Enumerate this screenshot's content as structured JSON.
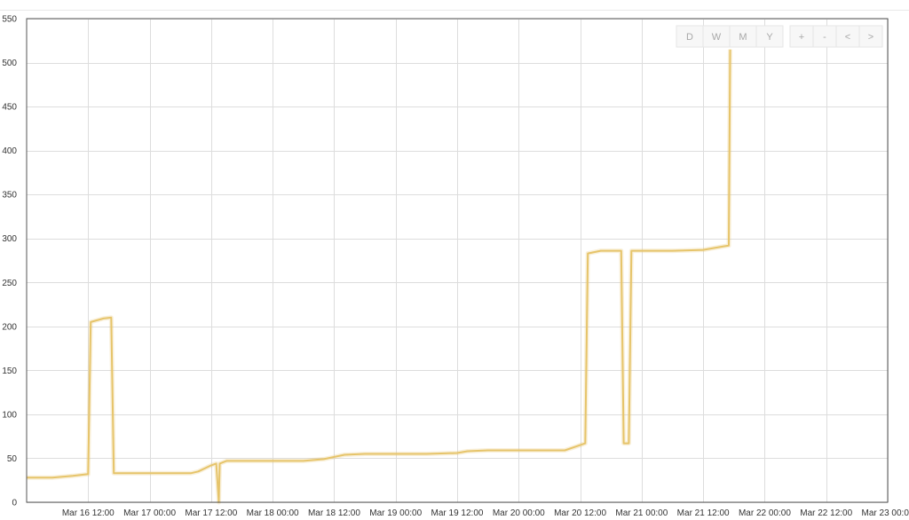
{
  "controls": {
    "range": [
      "D",
      "W",
      "M",
      "Y"
    ],
    "zoom": [
      "+",
      "-",
      "<",
      ">"
    ],
    "active": "W"
  },
  "colors": {
    "line": "#e6c46a",
    "grid": "#dddddd",
    "frame": "#555555"
  },
  "chart_data": {
    "type": "line",
    "title": "",
    "xlabel": "",
    "ylabel": "",
    "ylim": [
      0,
      550
    ],
    "xlim": [
      "2024-03-16 00:00",
      "2024-03-23 00:00"
    ],
    "yticks": [
      0,
      50,
      100,
      150,
      200,
      250,
      300,
      350,
      400,
      450,
      500,
      550
    ],
    "xticks": [
      {
        "t": "2024-03-16 12:00",
        "label": "Mar 16 12:00"
      },
      {
        "t": "2024-03-17 00:00",
        "label": "Mar 17 00:00"
      },
      {
        "t": "2024-03-17 12:00",
        "label": "Mar 17 12:00"
      },
      {
        "t": "2024-03-18 00:00",
        "label": "Mar 18 00:00"
      },
      {
        "t": "2024-03-18 12:00",
        "label": "Mar 18 12:00"
      },
      {
        "t": "2024-03-19 00:00",
        "label": "Mar 19 00:00"
      },
      {
        "t": "2024-03-19 12:00",
        "label": "Mar 19 12:00"
      },
      {
        "t": "2024-03-20 00:00",
        "label": "Mar 20 00:00"
      },
      {
        "t": "2024-03-20 12:00",
        "label": "Mar 20 12:00"
      },
      {
        "t": "2024-03-21 00:00",
        "label": "Mar 21 00:00"
      },
      {
        "t": "2024-03-21 12:00",
        "label": "Mar 21 12:00"
      },
      {
        "t": "2024-03-22 00:00",
        "label": "Mar 22 00:00"
      },
      {
        "t": "2024-03-22 12:00",
        "label": "Mar 22 12:00"
      },
      {
        "t": "2024-03-23 00:00",
        "label": "Mar 23 00:00"
      }
    ],
    "grid": true,
    "legend": "none",
    "series": [
      {
        "color": "#e6c46a",
        "points": [
          [
            "2024-03-16 00:00",
            28
          ],
          [
            "2024-03-16 05:00",
            28
          ],
          [
            "2024-03-16 09:00",
            30
          ],
          [
            "2024-03-16 12:00",
            32
          ],
          [
            "2024-03-16 12:30",
            205
          ],
          [
            "2024-03-16 15:00",
            209
          ],
          [
            "2024-03-16 16:30",
            210
          ],
          [
            "2024-03-16 17:00",
            33
          ],
          [
            "2024-03-17 00:00",
            33
          ],
          [
            "2024-03-17 08:00",
            33
          ],
          [
            "2024-03-17 09:30",
            35
          ],
          [
            "2024-03-17 12:00",
            42
          ],
          [
            "2024-03-17 13:00",
            44
          ],
          [
            "2024-03-17 13:30",
            0
          ],
          [
            "2024-03-17 13:40",
            44
          ],
          [
            "2024-03-17 15:00",
            47
          ],
          [
            "2024-03-18 00:00",
            47
          ],
          [
            "2024-03-18 06:00",
            47
          ],
          [
            "2024-03-18 10:00",
            49
          ],
          [
            "2024-03-18 14:00",
            54
          ],
          [
            "2024-03-18 18:00",
            55
          ],
          [
            "2024-03-19 00:00",
            55
          ],
          [
            "2024-03-19 06:00",
            55
          ],
          [
            "2024-03-19 12:00",
            56
          ],
          [
            "2024-03-19 14:00",
            58
          ],
          [
            "2024-03-19 18:00",
            59
          ],
          [
            "2024-03-20 00:00",
            59
          ],
          [
            "2024-03-20 09:00",
            59
          ],
          [
            "2024-03-20 11:00",
            63
          ],
          [
            "2024-03-20 13:00",
            67
          ],
          [
            "2024-03-20 13:30",
            283
          ],
          [
            "2024-03-20 16:00",
            286
          ],
          [
            "2024-03-20 20:00",
            286
          ],
          [
            "2024-03-20 20:30",
            67
          ],
          [
            "2024-03-20 21:30",
            67
          ],
          [
            "2024-03-20 22:00",
            286
          ],
          [
            "2024-03-21 06:00",
            286
          ],
          [
            "2024-03-21 12:00",
            287
          ],
          [
            "2024-03-21 16:00",
            291
          ],
          [
            "2024-03-21 17:00",
            292
          ],
          [
            "2024-03-21 17:15",
            515
          ]
        ]
      }
    ]
  }
}
